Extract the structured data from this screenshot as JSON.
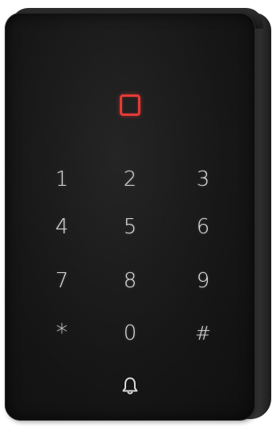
{
  "device": {
    "indicator_color": "#e63a36",
    "rfid_indicator_icon": "rfid-card-reader-icon",
    "keypad": {
      "row1": [
        "1",
        "2",
        "3"
      ],
      "row2": [
        "4",
        "5",
        "6"
      ],
      "row3": [
        "7",
        "8",
        "9"
      ],
      "row4": [
        "*",
        "0",
        "#"
      ],
      "doorbell_icon": "bell-icon"
    }
  }
}
